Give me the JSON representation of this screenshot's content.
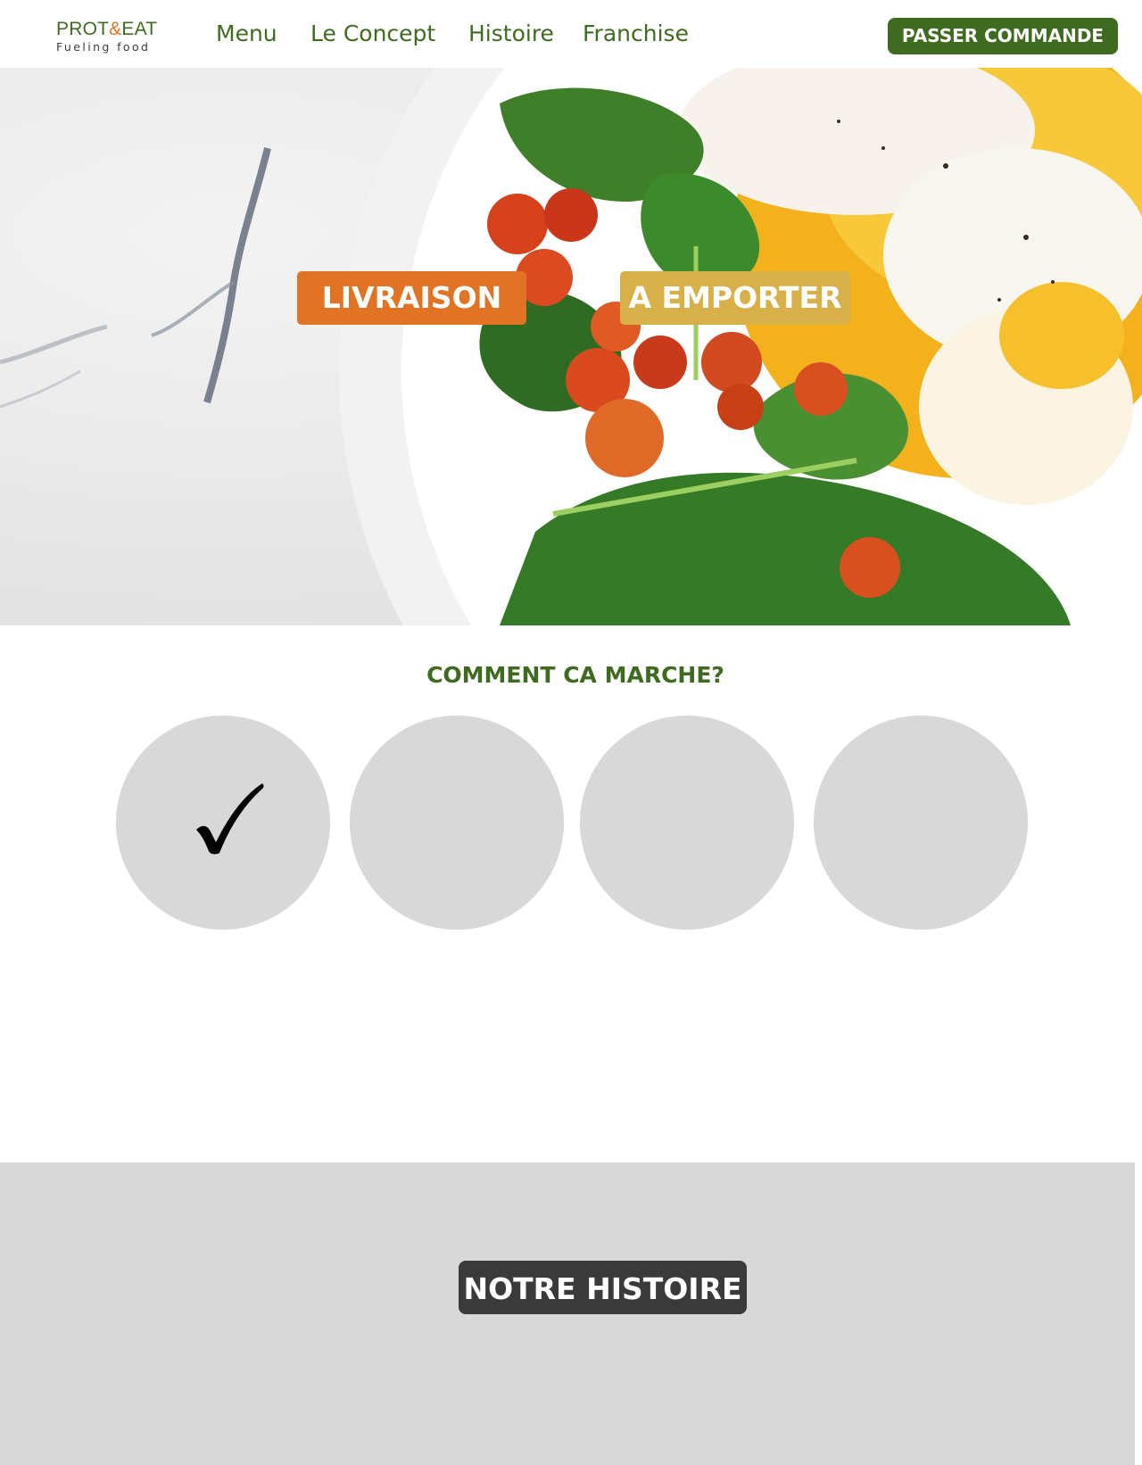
{
  "header": {
    "logo": {
      "main_left": "PROT",
      "amp": "&",
      "main_right": "EAT",
      "tagline": "Fueling food"
    },
    "nav": [
      {
        "label": "Menu"
      },
      {
        "label": "Le Concept"
      },
      {
        "label": "Histoire"
      },
      {
        "label": "Franchise"
      }
    ],
    "order_button": "PASSER COMMANDE"
  },
  "hero": {
    "buttons": {
      "livraison": "LIVRAISON",
      "emporter": "A EMPORTER"
    }
  },
  "how_it_works": {
    "title": "COMMENT CA MARCHE?",
    "steps": [
      {
        "icon": "checkmark-icon"
      },
      {
        "icon": ""
      },
      {
        "icon": ""
      },
      {
        "icon": ""
      }
    ]
  },
  "histoire": {
    "button": "NOTRE HISTOIRE"
  },
  "colors": {
    "brand_green": "#3f6b21",
    "orange": "#e07424",
    "mustard": "#d8b04a",
    "gray": "#d8d8d8",
    "dark": "#3a3a3a"
  }
}
